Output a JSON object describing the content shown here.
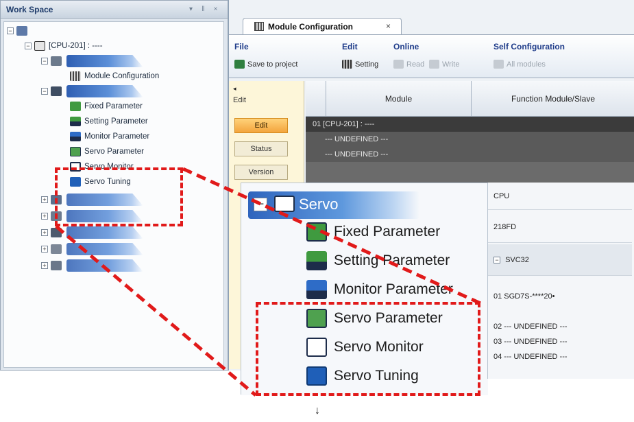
{
  "workspace": {
    "title": "Work Space",
    "controls": [
      "▾",
      "‖",
      "×"
    ],
    "tree": {
      "root_label": "",
      "cpu_label": "[CPU-201] : ----",
      "items": [
        {
          "label": "",
          "level": 2,
          "type": "section"
        },
        {
          "label": "Module Configuration",
          "level": 3,
          "type": "item"
        },
        {
          "label": "",
          "level": 2,
          "type": "section"
        },
        {
          "label": "Fixed Parameter",
          "level": 3,
          "type": "item"
        },
        {
          "label": "Setting Parameter",
          "level": 3,
          "type": "item"
        },
        {
          "label": "Monitor Parameter",
          "level": 3,
          "type": "item"
        },
        {
          "label": "Servo Parameter",
          "level": 3,
          "type": "item"
        },
        {
          "label": "Servo Monitor",
          "level": 3,
          "type": "item"
        },
        {
          "label": "Servo Tuning",
          "level": 3,
          "type": "item"
        }
      ]
    }
  },
  "tab": {
    "label": "Module Configuration",
    "close": "×"
  },
  "ribbon": {
    "groups": [
      {
        "name": "File",
        "buttons": [
          "Save to project"
        ]
      },
      {
        "name": "Edit",
        "buttons": [
          "Setting"
        ]
      },
      {
        "name": "Online",
        "buttons": [
          "Read",
          "Write"
        ]
      },
      {
        "name": "Self Configuration",
        "buttons": [
          "All modules"
        ]
      }
    ]
  },
  "side_panel": {
    "arrow": "◂",
    "title": "Edit",
    "buttons": [
      "Edit",
      "Status",
      "Version"
    ]
  },
  "grid": {
    "headers": [
      "Module",
      "Function Module/Slave"
    ],
    "rows": [
      "01 [CPU-201] : ----",
      "--- UNDEFINED ---",
      "--- UNDEFINED ---"
    ]
  },
  "zoom": {
    "section_label": "Servo",
    "items": [
      "Fixed Parameter",
      "Setting Parameter",
      "Monitor Parameter",
      "Servo Parameter",
      "Servo Monitor",
      "Servo Tuning"
    ],
    "grid_rows": [
      "CPU",
      "218FD",
      "SVC32",
      "01 SGD7S-****20•",
      "02 --- UNDEFINED ---",
      "03 --- UNDEFINED ---",
      "04 --- UNDEFINED ---"
    ],
    "clipped_label": "SVC32"
  },
  "arrow_down": "↓",
  "colors": {
    "highlight": "#e11a1a",
    "ribbon_group": "#1f3c8a",
    "tree_bar": "#2f5fb3",
    "edit_button": "#f3a43c"
  }
}
